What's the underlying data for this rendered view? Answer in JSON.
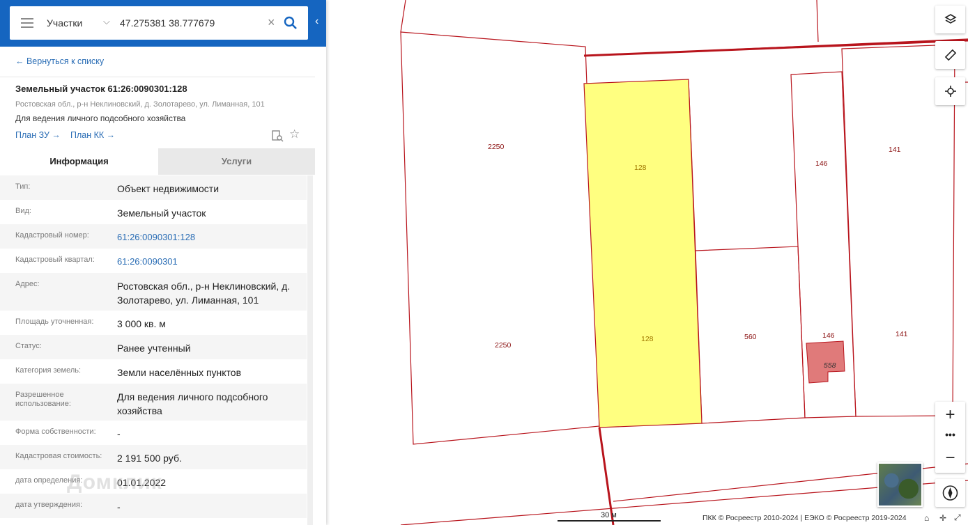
{
  "search": {
    "category": "Участки",
    "query": "47.275381 38.777679"
  },
  "panel": {
    "back_label": "← Вернуться к списку",
    "title": "Земельный участок 61:26:0090301:128",
    "address_short": "Ростовская обл., р-н Неклиновский, д. Золотарево, ул. Лиманная, 101",
    "use": "Для ведения личного подсобного хозяйства",
    "plan_zu": "План ЗУ →",
    "plan_kk": "План КК →"
  },
  "tabs": {
    "info": "Информация",
    "services": "Услуги"
  },
  "info_rows": [
    {
      "label": "Тип:",
      "value": "Объект недвижимости"
    },
    {
      "label": "Вид:",
      "value": "Земельный участок"
    },
    {
      "label": "Кадастровый номер:",
      "value": "61:26:0090301:128"
    },
    {
      "label": "Кадастровый квартал:",
      "value": "61:26:0090301"
    },
    {
      "label": "Адрес:",
      "value": "Ростовская обл., р-н Неклиновский, д. Золотарево, ул. Лиманная, 101"
    },
    {
      "label": "Площадь уточненная:",
      "value": "3 000 кв. м"
    },
    {
      "label": "Статус:",
      "value": "Ранее учтенный"
    },
    {
      "label": "Категория земель:",
      "value": "Земли населённых пунктов"
    },
    {
      "label": "Разрешенное использование:",
      "value": "Для ведения личного подсобного хозяйства"
    },
    {
      "label": "Форма собственности:",
      "value": "-"
    },
    {
      "label": "Кадастровая стоимость:",
      "value": "2 191 500 руб."
    },
    {
      "label": "дата определения:",
      "value": "01.01.2022"
    },
    {
      "label": "дата утверждения:",
      "value": "-"
    }
  ],
  "watermark": "Домклик",
  "map": {
    "parcel_labels": [
      "2250",
      "128",
      "146",
      "141",
      "2250",
      "128",
      "560",
      "146",
      "141",
      "558"
    ],
    "scale_label": "30 м",
    "copyright": "ПКК © Росреестр 2010-2024 | ЕЭКО © Росреестр 2019-2024",
    "colors": {
      "boundary": "#b8141c",
      "selected_fill": "#ffff80",
      "building_fill": "#e07a7a",
      "label": "#8b1010"
    }
  },
  "icons": {
    "layers": "layers-icon",
    "ruler": "ruler-icon",
    "locate": "locate-icon",
    "compass": "compass-icon",
    "home": "home-icon"
  }
}
